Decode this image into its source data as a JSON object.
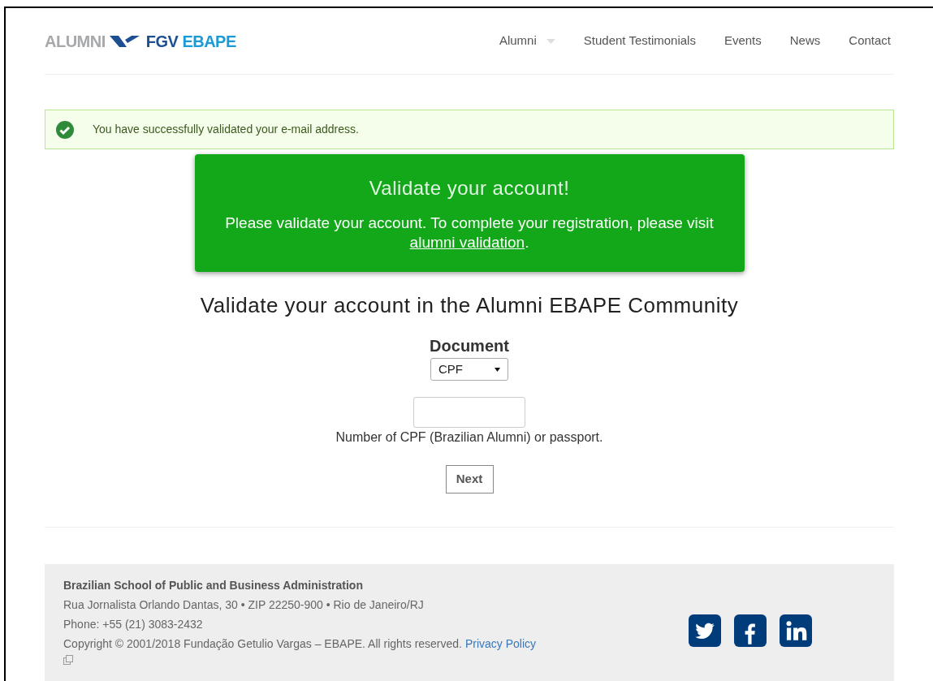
{
  "logo": {
    "word": "ALUMNI",
    "brand": "FGV",
    "school": "EBAPE"
  },
  "nav": [
    {
      "label": "Alumni",
      "kind": "dropdown"
    },
    {
      "label": "Student Testimonials",
      "kind": "link"
    },
    {
      "label": "Events",
      "kind": "link"
    },
    {
      "label": "News",
      "kind": "link"
    },
    {
      "label": "Contact",
      "kind": "link"
    }
  ],
  "success_alert": {
    "text": "You have successfully validated your e-mail address."
  },
  "validate_box": {
    "title": "Validate your account!",
    "text_before": "Please validate your account. To complete your registration, please visit ",
    "link": "alumni validation",
    "text_after": "."
  },
  "form": {
    "heading": "Validate your account in the Alumni EBAPE Community",
    "document_label": "Document",
    "document_value": "CPF",
    "number_help": "Number of CPF (Brazilian Alumni) or passport.",
    "next_button": "Next"
  },
  "footer": {
    "school": "Brazilian School of Public and Business Administration",
    "address": "Rua Jornalista Orlando Dantas, 30 • ZIP 22250-900 • Rio de Janeiro/RJ",
    "phone": "Phone: +55 (21) 3083-2432",
    "copyright": "Copyright © 2001/2018 Fundação Getulio Vargas – EBAPE. All rights reserved. ",
    "privacy_link": "Privacy Policy",
    "social": [
      {
        "kind": "twitter"
      },
      {
        "kind": "facebook"
      },
      {
        "kind": "linkedin"
      }
    ]
  }
}
